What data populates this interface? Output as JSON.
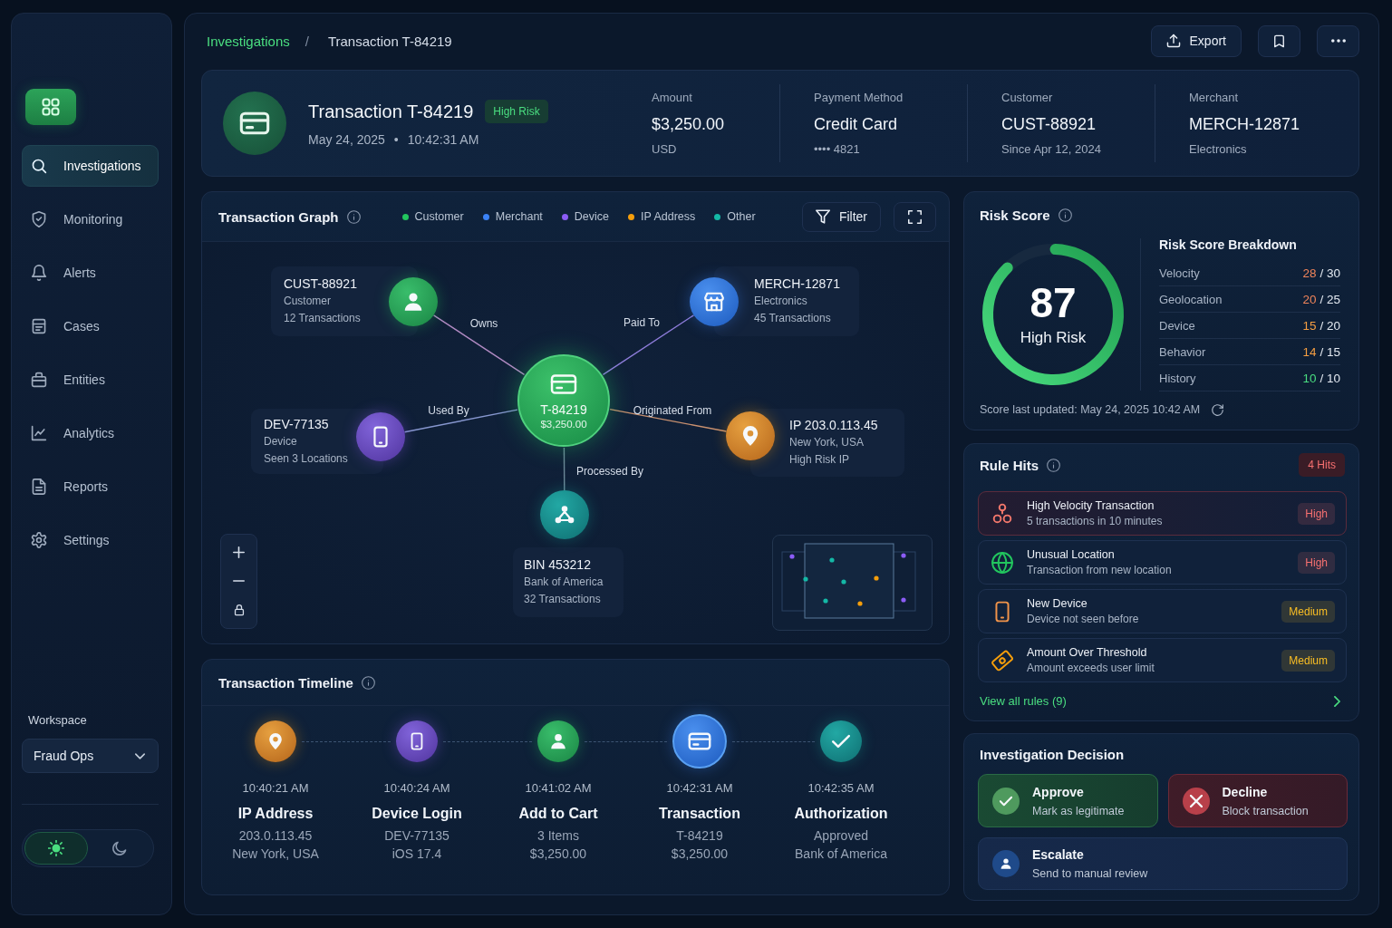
{
  "sidebar": {
    "items": [
      {
        "label": "Investigations",
        "selected": true
      },
      {
        "label": "Monitoring",
        "selected": false
      },
      {
        "label": "Alerts",
        "selected": false
      },
      {
        "label": "Cases",
        "selected": false
      },
      {
        "label": "Entities",
        "selected": false
      },
      {
        "label": "Analytics",
        "selected": false
      },
      {
        "label": "Reports",
        "selected": false
      },
      {
        "label": "Settings",
        "selected": false
      }
    ],
    "workspace": {
      "label": "Workspace",
      "value": "Fraud Ops"
    },
    "theme": [
      {
        "kind": "light",
        "selected": true
      },
      {
        "kind": "dark",
        "selected": false
      }
    ]
  },
  "header": {
    "breadcrumb": [
      "Investigations",
      "Transaction T-84219"
    ],
    "separator": "/",
    "actions": [
      {
        "kind": "export",
        "label": "Export"
      },
      {
        "kind": "bookmark"
      },
      {
        "kind": "more"
      }
    ]
  },
  "summary": {
    "title": "Transaction T-84219",
    "badge": "High Risk",
    "date": "May 24, 2025",
    "separator": "•",
    "time": "10:42:31 AM",
    "fields": [
      {
        "label": "Amount",
        "value": "$3,250.00",
        "detail": "USD"
      },
      {
        "label": "Payment Method",
        "value": "Credit Card",
        "detail": "•••• 4821"
      },
      {
        "label": "Customer",
        "value": "CUST-88921",
        "detail": "Since Apr 12, 2024"
      },
      {
        "label": "Merchant",
        "value": "MERCH-12871",
        "detail": "Electronics"
      }
    ]
  },
  "graph": {
    "title": "Transaction Graph",
    "legend": [
      {
        "label": "Customer",
        "color": "#22c55e"
      },
      {
        "label": "Merchant",
        "color": "#3b82f6"
      },
      {
        "label": "Device",
        "color": "#8b5cf6"
      },
      {
        "label": "IP Address",
        "color": "#f59e0b"
      },
      {
        "label": "Other",
        "color": "#14b8a6"
      }
    ],
    "filter": "Filter",
    "center": {
      "title": "T-84219",
      "detail": "$3,250.00"
    },
    "nodes": [
      {
        "kind": "customer",
        "title": "CUST-88921",
        "lines": [
          "Customer",
          "12 Transactions"
        ],
        "edge_label": "Owns"
      },
      {
        "kind": "merchant",
        "title": "MERCH-12871",
        "lines": [
          "Electronics",
          "45 Transactions"
        ],
        "edge_label": "Paid To"
      },
      {
        "kind": "device",
        "title": "DEV-77135",
        "lines": [
          "Device",
          "Seen 3 Locations"
        ],
        "edge_label": "Used By"
      },
      {
        "kind": "ip",
        "title": "IP 203.0.113.45",
        "lines": [
          "New York, USA",
          "High Risk IP"
        ],
        "edge_label": "Originated From"
      },
      {
        "kind": "other",
        "title": "BIN 453212",
        "lines": [
          "Bank of America",
          "32 Transactions"
        ],
        "edge_label": "Processed By"
      }
    ]
  },
  "timeline": {
    "title": "Transaction Timeline",
    "events": [
      {
        "kind": "ip",
        "current": false,
        "time": "10:40:21 AM",
        "title": "IP Address",
        "lines": [
          "203.0.113.45",
          "New York, USA"
        ]
      },
      {
        "kind": "device",
        "current": false,
        "time": "10:40:24 AM",
        "title": "Device Login",
        "lines": [
          "DEV-77135",
          "iOS 17.4"
        ]
      },
      {
        "kind": "cart",
        "current": false,
        "time": "10:41:02 AM",
        "title": "Add to Cart",
        "lines": [
          "3 Items",
          "$3,250.00"
        ]
      },
      {
        "kind": "transaction",
        "current": true,
        "time": "10:42:31 AM",
        "title": "Transaction",
        "lines": [
          "T-84219",
          "$3,250.00"
        ]
      },
      {
        "kind": "authorization",
        "current": false,
        "time": "10:42:35 AM",
        "title": "Authorization",
        "lines": [
          "Approved",
          "Bank of America"
        ]
      }
    ]
  },
  "risk_score": {
    "title": "Risk Score",
    "score": "87",
    "level": 0.87,
    "label": "High Risk",
    "breakdown_title": "Risk Score Breakdown",
    "breakdown": [
      {
        "label": "Velocity",
        "score": "28",
        "max": "/ 30",
        "color": "#f0845a"
      },
      {
        "label": "Geolocation",
        "score": "20",
        "max": "/ 25",
        "color": "#f0845a"
      },
      {
        "label": "Device",
        "score": "15",
        "max": "/ 20",
        "color": "#f59e42"
      },
      {
        "label": "Behavior",
        "score": "14",
        "max": "/ 15",
        "color": "#f59e42"
      },
      {
        "label": "History",
        "score": "10",
        "max": "/ 10",
        "color": "#4ade80"
      }
    ],
    "updated": "Score last updated: May 24, 2025 10:42 AM"
  },
  "rule_hits": {
    "title": "Rule Hits",
    "count": "4 Hits",
    "rules": [
      {
        "kind": "velocity",
        "selected": true,
        "title": "High Velocity Transaction",
        "detail": "5 transactions in 10 minutes",
        "severity": "High",
        "color": "#f87171"
      },
      {
        "kind": "location",
        "selected": false,
        "title": "Unusual Location",
        "detail": "Transaction from new location",
        "severity": "High",
        "color": "#f87171"
      },
      {
        "kind": "device",
        "selected": false,
        "title": "New Device",
        "detail": "Device not seen before",
        "severity": "Medium",
        "color": "#fbbf24"
      },
      {
        "kind": "amount",
        "selected": false,
        "title": "Amount Over Threshold",
        "detail": "Amount exceeds user limit",
        "severity": "Medium",
        "color": "#fbbf24"
      }
    ],
    "link": "View all rules (9)"
  },
  "decision": {
    "title": "Investigation Decision",
    "options": [
      {
        "kind": "approve",
        "label": "Approve",
        "detail": "Mark as legitimate"
      },
      {
        "kind": "decline",
        "label": "Decline",
        "detail": "Block transaction"
      },
      {
        "kind": "escalate",
        "label": "Escalate",
        "detail": "Send to manual review"
      }
    ]
  }
}
